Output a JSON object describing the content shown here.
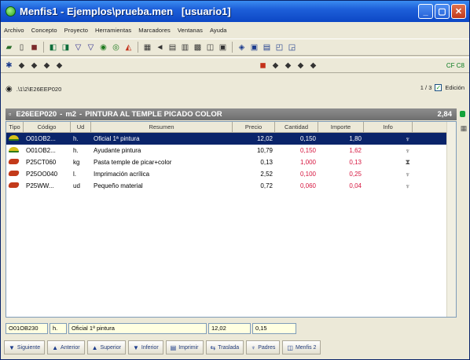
{
  "window": {
    "title": "Menfis1 - Ejemplos\\prueba.men   [usuario1]",
    "controls": [
      "_",
      "▢",
      "✕"
    ]
  },
  "menu": [
    "Archivo",
    "Concepto",
    "Proyecto",
    "Herramientas",
    "Marcadores",
    "Ventanas",
    "Ayuda"
  ],
  "toolbar2_right": "CF C8",
  "path": {
    "value": ".\\1\\2\\E26EEP020",
    "page": "1 / 3",
    "edit_label": "Edición",
    "edit_checked": true
  },
  "concept": {
    "code": "E26EEP020",
    "unit": "m2",
    "description": "PINTURA AL TEMPLE PICADO COLOR",
    "amount": "2,84"
  },
  "grid": {
    "columns": [
      "Tipo",
      "Código",
      "Ud",
      "Resumen",
      "Precio",
      "Cantidad",
      "Importe",
      "Info"
    ],
    "rows": [
      {
        "type_icon": "worker-hat-icon",
        "code": "O01OB2...",
        "unit": "h.",
        "summary": "Oficial 1ª pintura",
        "price": "12,02",
        "quantity": "0,150",
        "amount": "1,80",
        "selected": true
      },
      {
        "type_icon": "worker-hat-icon",
        "code": "O01OB2...",
        "unit": "h.",
        "summary": "Ayudante pintura",
        "price": "10,79",
        "quantity": "0,150",
        "amount": "1,62",
        "selected": false
      },
      {
        "type_icon": "material-brick-icon",
        "code": "P25CT060",
        "unit": "kg",
        "summary": "Pasta temple de picar+color",
        "price": "0,13",
        "quantity": "1,000",
        "amount": "0,13",
        "selected": false
      },
      {
        "type_icon": "material-brick-icon",
        "code": "P25OO040",
        "unit": "l.",
        "summary": "Imprimación acrílica",
        "price": "2,52",
        "quantity": "0,100",
        "amount": "0,25",
        "selected": false
      },
      {
        "type_icon": "material-brick-icon",
        "code": "P25WW...",
        "unit": "ud",
        "summary": "Pequeño material",
        "price": "0,72",
        "quantity": "0,060",
        "amount": "0,04",
        "selected": false
      }
    ]
  },
  "editbar": {
    "code": "O01OB230",
    "unit": "h.",
    "summary": "Oficial 1ª pintura",
    "price": "12,02",
    "quantity": "0,15"
  },
  "bottom_buttons": [
    {
      "label": "Siguiente",
      "icon": "arrow-down-icon"
    },
    {
      "label": "Anterior",
      "icon": "arrow-up-icon"
    },
    {
      "label": "Superior",
      "icon": "arrow-up-icon"
    },
    {
      "label": "Inferior",
      "icon": "arrow-down-icon"
    },
    {
      "label": "Imprimir",
      "icon": "printer-icon"
    },
    {
      "label": "Traslada",
      "icon": "transfer-icon"
    },
    {
      "label": "Padres",
      "icon": "parents-icon"
    },
    {
      "label": "Menfis 2",
      "icon": "menfis-icon"
    }
  ],
  "colors": {
    "selection": "#0a246a",
    "titlebar": "#1d5fd9",
    "header_band": "#7a7a7a",
    "amount_red": "#d6153f"
  }
}
